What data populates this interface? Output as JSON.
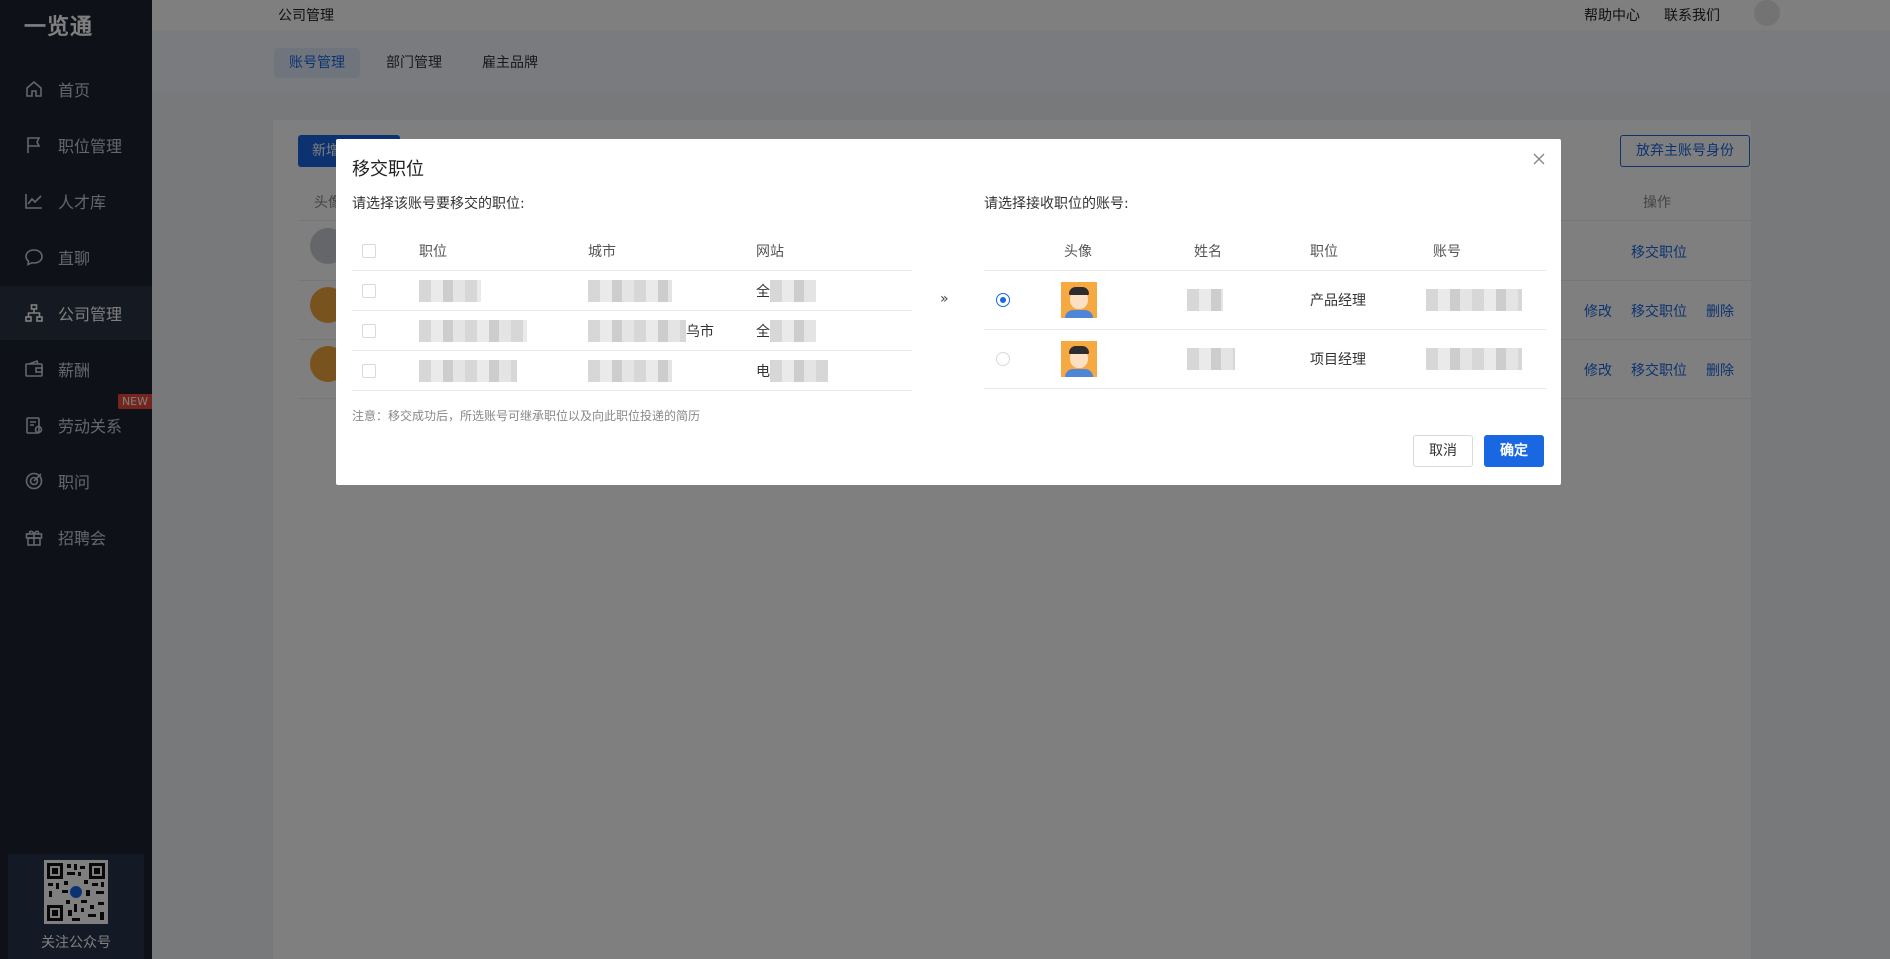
{
  "app": {
    "logo": "一览通"
  },
  "sidebar": {
    "items": [
      {
        "label": "首页",
        "icon": "home-icon"
      },
      {
        "label": "职位管理",
        "icon": "flag-icon"
      },
      {
        "label": "人才库",
        "icon": "chart-line-icon"
      },
      {
        "label": "直聊",
        "icon": "chat-bubble-icon"
      },
      {
        "label": "公司管理",
        "icon": "org-chart-icon",
        "active": true
      },
      {
        "label": "薪酬",
        "icon": "wallet-icon"
      },
      {
        "label": "劳动关系",
        "icon": "contract-icon",
        "badge": "NEW"
      },
      {
        "label": "职问",
        "icon": "target-icon"
      },
      {
        "label": "招聘会",
        "icon": "gift-icon"
      }
    ],
    "qr_label": "关注公众号"
  },
  "header": {
    "title": "公司管理",
    "links": [
      "帮助中心",
      "联系我们"
    ]
  },
  "subnav": {
    "tabs": [
      {
        "label": "账号管理",
        "active": true
      },
      {
        "label": "部门管理"
      },
      {
        "label": "雇主品牌"
      }
    ]
  },
  "background": {
    "new_button": "新增",
    "abandon_button": "放弃主账号身份",
    "col_avatar": "头像",
    "col_ops": "操作",
    "rows": [
      {
        "actions": [
          "移交职位"
        ]
      },
      {
        "actions": [
          "修改",
          "移交职位",
          "删除"
        ]
      },
      {
        "actions": [
          "修改",
          "移交职位",
          "删除"
        ]
      }
    ]
  },
  "modal": {
    "title": "移交职位",
    "left_label": "请选择该账号要移交的职位:",
    "right_label": "请选择接收职位的账号:",
    "left_columns": [
      "职位",
      "城市",
      "网站"
    ],
    "left_rows": [
      {
        "position": "",
        "city": "",
        "site": "全"
      },
      {
        "position": "",
        "city": "乌市",
        "site": "全"
      },
      {
        "position": "",
        "city": "",
        "site": "电"
      }
    ],
    "right_columns": [
      "头像",
      "姓名",
      "职位",
      "账号"
    ],
    "right_rows": [
      {
        "selected": true,
        "position": "产品经理"
      },
      {
        "selected": false,
        "position": "项目经理"
      }
    ],
    "transfer_arrow": "»",
    "note": "注意：移交成功后，所选账号可继承职位以及向此职位投递的简历",
    "cancel": "取消",
    "confirm": "确定",
    "accent": "#1967e1"
  }
}
